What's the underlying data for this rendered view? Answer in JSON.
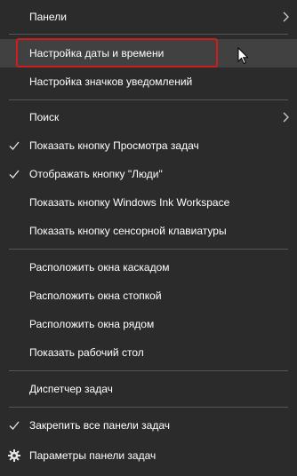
{
  "menu": {
    "items": [
      {
        "label": "Панели"
      },
      {
        "label": "Настройка даты и времени"
      },
      {
        "label": "Настройка значков уведомлений"
      },
      {
        "label": "Поиск"
      },
      {
        "label": "Показать кнопку Просмотра задач"
      },
      {
        "label": "Отображать кнопку \"Люди\""
      },
      {
        "label": "Показать кнопку Windows Ink Workspace"
      },
      {
        "label": "Показать кнопку сенсорной клавиатуры"
      },
      {
        "label": "Расположить окна каскадом"
      },
      {
        "label": "Расположить окна стопкой"
      },
      {
        "label": "Расположить окна рядом"
      },
      {
        "label": "Показать рабочий стол"
      },
      {
        "label": "Диспетчер задач"
      },
      {
        "label": "Закрепить все панели задач"
      },
      {
        "label": "Параметры панели задач"
      }
    ]
  },
  "states": {
    "show_task_view_checked": true,
    "show_people_checked": true,
    "lock_taskbars_checked": true
  },
  "icons": {
    "check": "check-icon",
    "gear": "gear-icon",
    "submenu": "chevron-right-icon",
    "cursor": "mouse-cursor-icon"
  },
  "colors": {
    "background": "#2b2b2b",
    "hover": "#414141",
    "separator": "#555555",
    "text": "#ffffff",
    "highlight_border": "#d01c1c"
  }
}
